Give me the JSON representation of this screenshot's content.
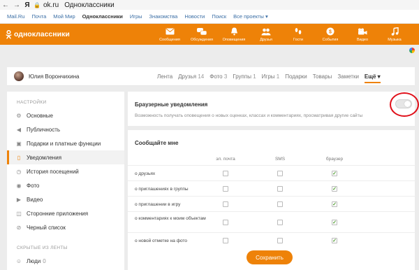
{
  "browser": {
    "back_icon": "arrow-left-icon",
    "forward_icon": "arrow-right-icon",
    "yandex_logo": "Я",
    "lock_icon": "lock-icon",
    "url": "ok.ru",
    "page_title": "Одноклассники"
  },
  "portal_links": [
    {
      "label": "Mail.Ru",
      "active": false
    },
    {
      "label": "Почта",
      "active": false
    },
    {
      "label": "Мой Мир",
      "active": false
    },
    {
      "label": "Одноклассники",
      "active": true
    },
    {
      "label": "Игры",
      "active": false
    },
    {
      "label": "Знакомства",
      "active": false
    },
    {
      "label": "Новости",
      "active": false
    },
    {
      "label": "Поиск",
      "active": false
    },
    {
      "label": "Все проекты ▾",
      "active": false
    }
  ],
  "topbar": {
    "logo_text": "одноклассники",
    "accent": "#ee8208",
    "nav": [
      {
        "label": "Сообщения",
        "icon": "envelope-icon"
      },
      {
        "label": "Обсуждения",
        "icon": "chat-bubbles-icon"
      },
      {
        "label": "Оповещения",
        "icon": "bell-icon"
      },
      {
        "label": "Друзья",
        "icon": "friends-icon"
      },
      {
        "label": "Гости",
        "icon": "footprints-icon"
      },
      {
        "label": "События",
        "icon": "events-icon"
      },
      {
        "label": "Видео",
        "icon": "video-camera-icon"
      },
      {
        "label": "Музыка",
        "icon": "music-note-icon"
      }
    ]
  },
  "profile": {
    "name": "Юлия Ворончихина",
    "tabs": [
      {
        "label": "Лента",
        "count": ""
      },
      {
        "label": "Друзья",
        "count": "14"
      },
      {
        "label": "Фото",
        "count": "3"
      },
      {
        "label": "Группы",
        "count": "1"
      },
      {
        "label": "Игры",
        "count": "1"
      },
      {
        "label": "Подарки",
        "count": ""
      },
      {
        "label": "Товары",
        "count": ""
      },
      {
        "label": "Заметки",
        "count": ""
      }
    ],
    "more_label": "Ещё ▾"
  },
  "sidebar": {
    "settings_header": "НАСТРОЙКИ",
    "items": [
      {
        "label": "Основные",
        "icon": "gear-icon",
        "glyph": "⚙"
      },
      {
        "label": "Публичность",
        "icon": "megaphone-icon",
        "glyph": "◀"
      },
      {
        "label": "Подарки и платные функции",
        "icon": "gift-icon",
        "glyph": "▣"
      },
      {
        "label": "Уведомления",
        "icon": "notification-icon",
        "glyph": "▯",
        "active": true
      },
      {
        "label": "История посещений",
        "icon": "history-icon",
        "glyph": "◷"
      },
      {
        "label": "Фото",
        "icon": "camera-icon",
        "glyph": "◉"
      },
      {
        "label": "Видео",
        "icon": "video-icon",
        "glyph": "▶"
      },
      {
        "label": "Сторонние приложения",
        "icon": "apps-icon",
        "glyph": "◫"
      },
      {
        "label": "Черный список",
        "icon": "blocked-user-icon",
        "glyph": "⊘"
      }
    ],
    "hidden_header": "СКРЫТЫЕ ИЗ ЛЕНТЫ",
    "hidden_items": [
      {
        "label": "Люди",
        "count": "0",
        "icon": "people-icon",
        "glyph": "☺"
      }
    ]
  },
  "browser_notifications": {
    "title": "Браузерные уведомления",
    "description": "Возможность получать оповещения о новых оценках, классах и комментариях, просматривая другие сайты",
    "enabled": false
  },
  "notify_me": {
    "title": "Сообщайте мне",
    "columns": [
      "эл. почта",
      "SMS",
      "браузер"
    ],
    "rows": [
      {
        "label": "о друзьях",
        "email": false,
        "sms": false,
        "browser": true
      },
      {
        "label": "о приглашениях в группы",
        "email": false,
        "sms": false,
        "browser": true
      },
      {
        "label": "о приглашении в игру",
        "email": false,
        "sms": false,
        "browser": true
      },
      {
        "label": "о комментариях к моим объектам",
        "email": false,
        "sms": false,
        "browser": true
      },
      {
        "label": "о новой отметке на фото",
        "email": false,
        "sms": false,
        "browser": true
      }
    ]
  },
  "save_label": "Сохранить",
  "highlight_color": "#e0101a"
}
